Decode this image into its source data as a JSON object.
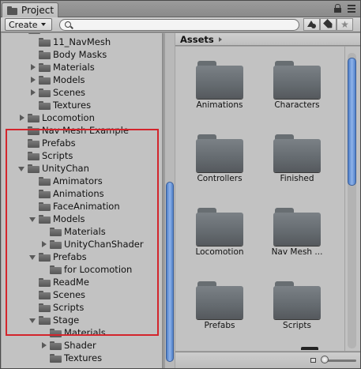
{
  "window": {
    "tab_title": "Project"
  },
  "toolbar": {
    "create_label": "Create",
    "search_value": "",
    "search_placeholder": ""
  },
  "tree": {
    "items": [
      {
        "label": "11_NavMesh",
        "depth": 1,
        "arrow": "none"
      },
      {
        "label": "Body Masks",
        "depth": 1,
        "arrow": "none"
      },
      {
        "label": "Materials",
        "depth": 1,
        "arrow": "right"
      },
      {
        "label": "Models",
        "depth": 1,
        "arrow": "right"
      },
      {
        "label": "Scenes",
        "depth": 1,
        "arrow": "right"
      },
      {
        "label": "Textures",
        "depth": 1,
        "arrow": "none"
      },
      {
        "label": "Locomotion",
        "depth": 0,
        "arrow": "right"
      },
      {
        "label": "Nav Mesh Example",
        "depth": 0,
        "arrow": "none"
      },
      {
        "label": "Prefabs",
        "depth": 0,
        "arrow": "none"
      },
      {
        "label": "Scripts",
        "depth": 0,
        "arrow": "none"
      },
      {
        "label": "UnityChan",
        "depth": 0,
        "arrow": "down"
      },
      {
        "label": "Amimators",
        "depth": 1,
        "arrow": "none"
      },
      {
        "label": "Animations",
        "depth": 1,
        "arrow": "none"
      },
      {
        "label": "FaceAnimation",
        "depth": 1,
        "arrow": "none"
      },
      {
        "label": "Models",
        "depth": 1,
        "arrow": "down"
      },
      {
        "label": "Materials",
        "depth": 2,
        "arrow": "none"
      },
      {
        "label": "UnityChanShader",
        "depth": 2,
        "arrow": "right"
      },
      {
        "label": "Prefabs",
        "depth": 1,
        "arrow": "down"
      },
      {
        "label": "for Locomotion",
        "depth": 2,
        "arrow": "none"
      },
      {
        "label": "ReadMe",
        "depth": 1,
        "arrow": "none"
      },
      {
        "label": "Scenes",
        "depth": 1,
        "arrow": "none"
      },
      {
        "label": "Scripts",
        "depth": 1,
        "arrow": "none"
      },
      {
        "label": "Stage",
        "depth": 1,
        "arrow": "down"
      },
      {
        "label": "Materials",
        "depth": 2,
        "arrow": "none"
      },
      {
        "label": "Shader",
        "depth": 2,
        "arrow": "right"
      },
      {
        "label": "Textures",
        "depth": 2,
        "arrow": "none"
      }
    ]
  },
  "grid": {
    "breadcrumb": "Assets",
    "assets": [
      {
        "label": "Animations"
      },
      {
        "label": "Characters"
      },
      {
        "label": "Controllers"
      },
      {
        "label": "Finished"
      },
      {
        "label": "Locomotion"
      },
      {
        "label": "Nav Mesh ..."
      },
      {
        "label": "Prefabs"
      },
      {
        "label": "Scripts"
      }
    ]
  },
  "colors": {
    "highlight_box": "#d3252c",
    "scroll_thumb": "#4f7fc8",
    "panel_bg": "#c2c2c2"
  }
}
